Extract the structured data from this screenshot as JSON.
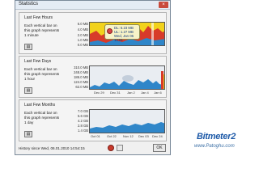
{
  "window": {
    "title": "Statistics",
    "close_glyph": "×"
  },
  "panels": [
    {
      "heading": "Last Few Hours",
      "description": "Each vertical bar on this graph represents 1 minute",
      "y_ticks": [
        "6.0 MB",
        "4.0 MB",
        "2.0 MB",
        "1.0 MB",
        "0.0 MB"
      ],
      "x_ticks": [],
      "tooltip": {
        "dl": "DL: 5.23 MB",
        "ul": "UL: 1.27 MB",
        "time": "Wed, Jan 06 14:51"
      }
    },
    {
      "heading": "Last Few Days",
      "description": "Each vertical bar on this graph represents 1 hour",
      "y_ticks": [
        "310.0 MB",
        "248.0 MB",
        "186.0 MB",
        "124.0 MB",
        "62.0 MB"
      ],
      "x_ticks": [
        "Dec 29",
        "Dec 31",
        "Jan 2",
        "Jan 4",
        "Jan 6"
      ]
    },
    {
      "heading": "Last Few Months",
      "description": "Each vertical bar on this graph represents 1 day",
      "y_ticks": [
        "7.0 GB",
        "5.6 GB",
        "4.2 GB",
        "2.8 GB",
        "1.4 GB"
      ],
      "x_ticks": [
        "Oct 01",
        "Oct 22",
        "Nov 12",
        "Dec 03",
        "Dec 24"
      ]
    }
  ],
  "footer": {
    "history": "History since Wed, 06.01.2010 14:54:15",
    "ok": "OK"
  },
  "watermark": {
    "brand": "Bitmeter2",
    "site": "www.Patoghu.com"
  },
  "colors": {
    "download": "#2f86c9",
    "upload": "#d83a2a",
    "overlap": "#f2d21b"
  },
  "icons": [
    "options-icon",
    "stop-icon",
    "save-icon",
    "clock-icon"
  ]
}
